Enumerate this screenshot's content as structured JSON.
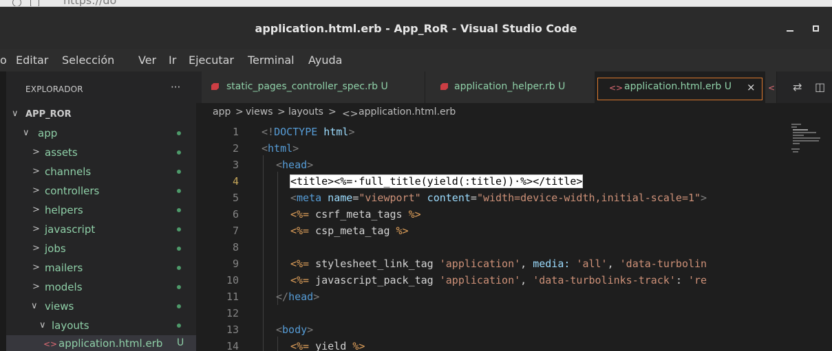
{
  "browser": {
    "url": "https://do"
  },
  "window": {
    "title": "application.html.erb - App_RoR - Visual Studio Code"
  },
  "menu": [
    "o",
    "Editar",
    "Selección",
    "Ver",
    "Ir",
    "Ejecutar",
    "Terminal",
    "Ayuda"
  ],
  "sidebar": {
    "header": "EXPLORADOR",
    "more": "···",
    "root": "APP_ROR",
    "items": [
      {
        "label": "app",
        "chevron": "∨"
      },
      {
        "label": "assets",
        "chevron": ">"
      },
      {
        "label": "channels",
        "chevron": ">"
      },
      {
        "label": "controllers",
        "chevron": ">"
      },
      {
        "label": "helpers",
        "chevron": ">"
      },
      {
        "label": "javascript",
        "chevron": ">"
      },
      {
        "label": "jobs",
        "chevron": ">"
      },
      {
        "label": "mailers",
        "chevron": ">"
      },
      {
        "label": "models",
        "chevron": ">"
      },
      {
        "label": "views",
        "chevron": "∨"
      },
      {
        "label": "layouts",
        "chevron": "∨"
      },
      {
        "label": "application.html.erb",
        "status": "U"
      }
    ]
  },
  "tabs": [
    {
      "label": "static_pages_controller_spec.rb U"
    },
    {
      "label": "application_helper.rb U"
    },
    {
      "label": "application.html.erb U",
      "close": "×"
    }
  ],
  "breadcrumb": {
    "p1": "app",
    "p2": "views",
    "p3": "layouts",
    "p4": "application.html.erb",
    "sep": ">"
  },
  "editor": {
    "lines": [
      "1",
      "2",
      "3",
      "4",
      "5",
      "6",
      "7",
      "8",
      "9",
      "10",
      "11",
      "12",
      "13",
      "14"
    ],
    "code": {
      "l1a": "<!",
      "l1b": "DOCTYPE",
      "l1c": " html",
      "l1d": ">",
      "l2a": "<",
      "l2b": "html",
      "l2c": ">",
      "l3a": "<",
      "l3b": "head",
      "l3c": ">",
      "l4": "<title><%=·full_title(yield(:title))·%></title>",
      "l5a": "<",
      "l5b": "meta",
      "l5c": " name",
      "l5d": "=",
      "l5e": "\"viewport\"",
      "l5f": " content",
      "l5g": "=",
      "l5h": "\"width=device-width,initial-scale=1\"",
      "l5i": ">",
      "l6a": "<%=",
      "l6b": " csrf_meta_tags ",
      "l6c": "%>",
      "l7a": "<%=",
      "l7b": " csp_meta_tag ",
      "l7c": "%>",
      "l9a": "<%=",
      "l9b": " stylesheet_link_tag ",
      "l9c": "'application'",
      "l9d": ", ",
      "l9e": "media:",
      "l9f": " ",
      "l9g": "'all'",
      "l9h": ", ",
      "l9i": "'data-turbolin",
      "l10a": "<%=",
      "l10b": " javascript_pack_tag ",
      "l10c": "'application'",
      "l10d": ", ",
      "l10e": "'data-turbolinks-track'",
      "l10f": ": ",
      "l10g": "'re",
      "l11a": "</",
      "l11b": "head",
      "l11c": ">",
      "l13a": "<",
      "l13b": "body",
      "l13c": ">",
      "l14a": "<%=",
      "l14b": " yield ",
      "l14c": "%>"
    }
  }
}
